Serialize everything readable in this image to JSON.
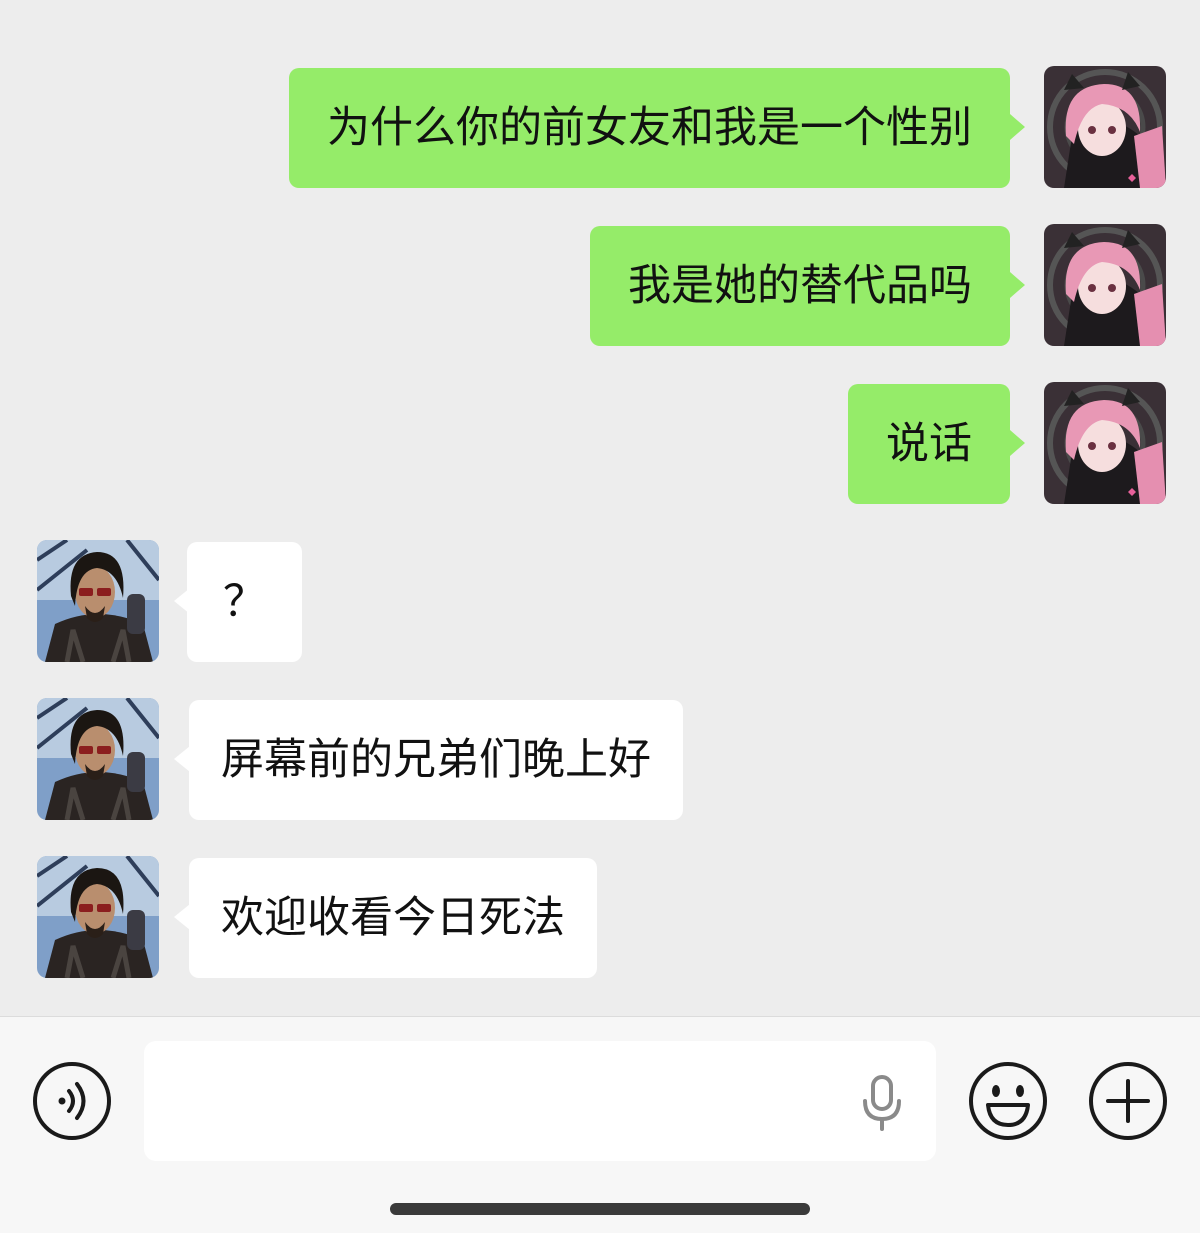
{
  "messages": [
    {
      "side": "mine",
      "text": "为什么你的前女友和我是一个性别"
    },
    {
      "side": "mine",
      "text": "我是她的替代品吗"
    },
    {
      "side": "mine",
      "text": "说话"
    },
    {
      "side": "theirs",
      "text": "？"
    },
    {
      "side": "theirs",
      "text": "屏幕前的兄弟们晚上好"
    },
    {
      "side": "theirs",
      "text": "欢迎收看今日死法"
    }
  ],
  "avatars": {
    "mine": "anime-girl-pink-hair-avatar",
    "theirs": "man-sunglasses-avatar"
  },
  "input": {
    "value": "",
    "placeholder": ""
  },
  "icons": {
    "voice": "voice-mode-icon",
    "mic": "microphone-icon",
    "emoji": "emoji-icon",
    "plus": "plus-icon"
  },
  "colors": {
    "background": "#ededed",
    "mine_bubble": "#95ec69",
    "theirs_bubble": "#ffffff"
  }
}
